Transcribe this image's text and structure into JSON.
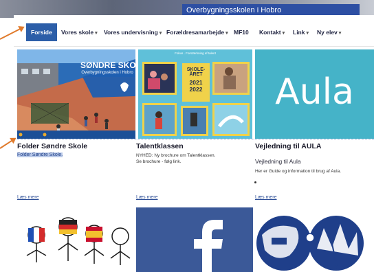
{
  "hero": {
    "banner_text": "Overbygningsskolen i Hobro"
  },
  "nav": {
    "items": [
      {
        "label": "Forside",
        "dropdown": false,
        "active": true
      },
      {
        "label": "Vores skole",
        "dropdown": true
      },
      {
        "label": "Vores undervisning",
        "dropdown": true
      },
      {
        "label": "Forældresamarbejde",
        "dropdown": true
      },
      {
        "label": "MF10",
        "dropdown": false
      },
      {
        "label": "Kontakt",
        "dropdown": true
      },
      {
        "label": "Link",
        "dropdown": true
      },
      {
        "label": "Ny elev",
        "dropdown": true
      }
    ],
    "chevron": "▾"
  },
  "cards": [
    {
      "title": "Folder Søndre Skole",
      "text": "Folder Søndre Skole.",
      "more": "Læs mere",
      "image": {
        "heading": "SØNDRE SKOLE",
        "subheading": "Overbygningsskolen i Hobro",
        "colors": {
          "bg": "#2b6cb7",
          "accent": "#e8ab2e"
        }
      }
    },
    {
      "title": "Talentklassen",
      "text_lines": [
        "NYHED: Ny brochure om Talentklassen.",
        "Se brochure - følg link."
      ],
      "more": "Læs mere",
      "image": {
        "top_text": "Fokus . Forstærkning af talent",
        "badge_lines": [
          "SKOLE-",
          "ÅRET",
          "2021",
          "2022"
        ],
        "colors": {
          "bg": "#5fc0d9",
          "frame": "#f0d24a"
        }
      }
    },
    {
      "title": "Vejledning til AULA",
      "subtitle": "Vejledning til Aula",
      "text": "Her er Guide og information til brug af Aula.",
      "more": "Læs mere",
      "image": {
        "logo": "Aula",
        "colors": {
          "bg": "#45b3c8"
        }
      }
    }
  ],
  "bottom_images": [
    {
      "name": "children-flags-drawing"
    },
    {
      "name": "facebook-logo",
      "glyph": "f",
      "colors": {
        "bg": "#3b5998"
      }
    },
    {
      "name": "world-collage-drawing"
    }
  ],
  "colors": {
    "nav_active": "#2c5ea8",
    "annotation_arrow": "#e07a2b"
  }
}
